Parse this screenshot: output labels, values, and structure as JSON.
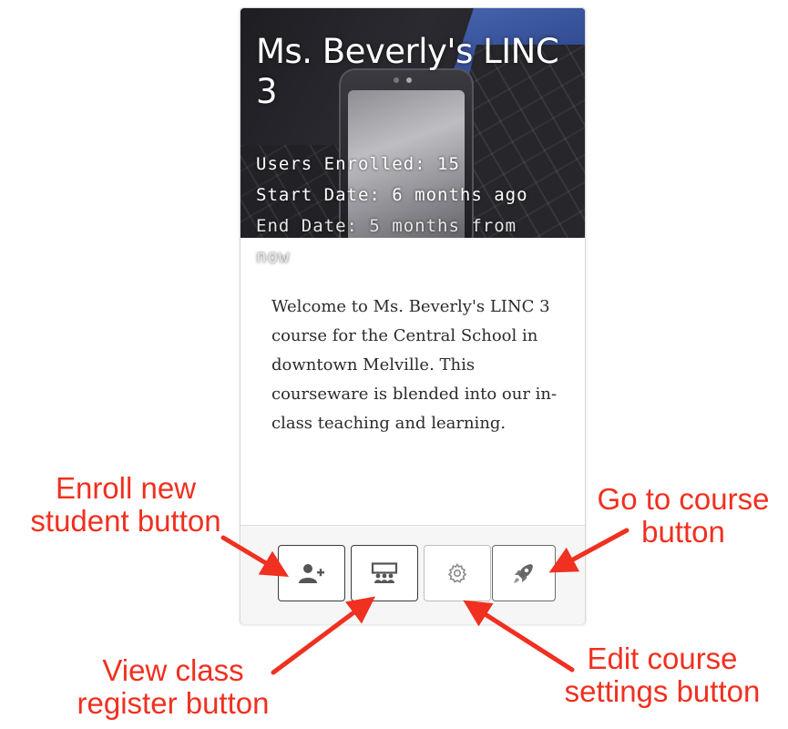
{
  "course": {
    "title": "Ms. Beverly's LINC 3",
    "users_enrolled": "Users Enrolled: 15",
    "start_date": "Start Date: 6 months ago",
    "end_date": "End Date: 5 months from now",
    "summary": "Welcome to Ms. Beverly's LINC 3 course for the Central School in downtown Melville.  This courseware is blended into our in-class teaching and learning."
  },
  "buttons": [
    {
      "icon": "user-plus-icon"
    },
    {
      "icon": "classroom-icon"
    },
    {
      "icon": "gear-icon"
    },
    {
      "icon": "rocket-icon"
    }
  ],
  "annotations": {
    "enroll": "Enroll new student button",
    "go_to_course": "Go to course button",
    "register": "View class register button",
    "settings": "Edit course settings button"
  },
  "colors": {
    "annotation": "#f03020",
    "button_border": "#3b3b3b"
  }
}
